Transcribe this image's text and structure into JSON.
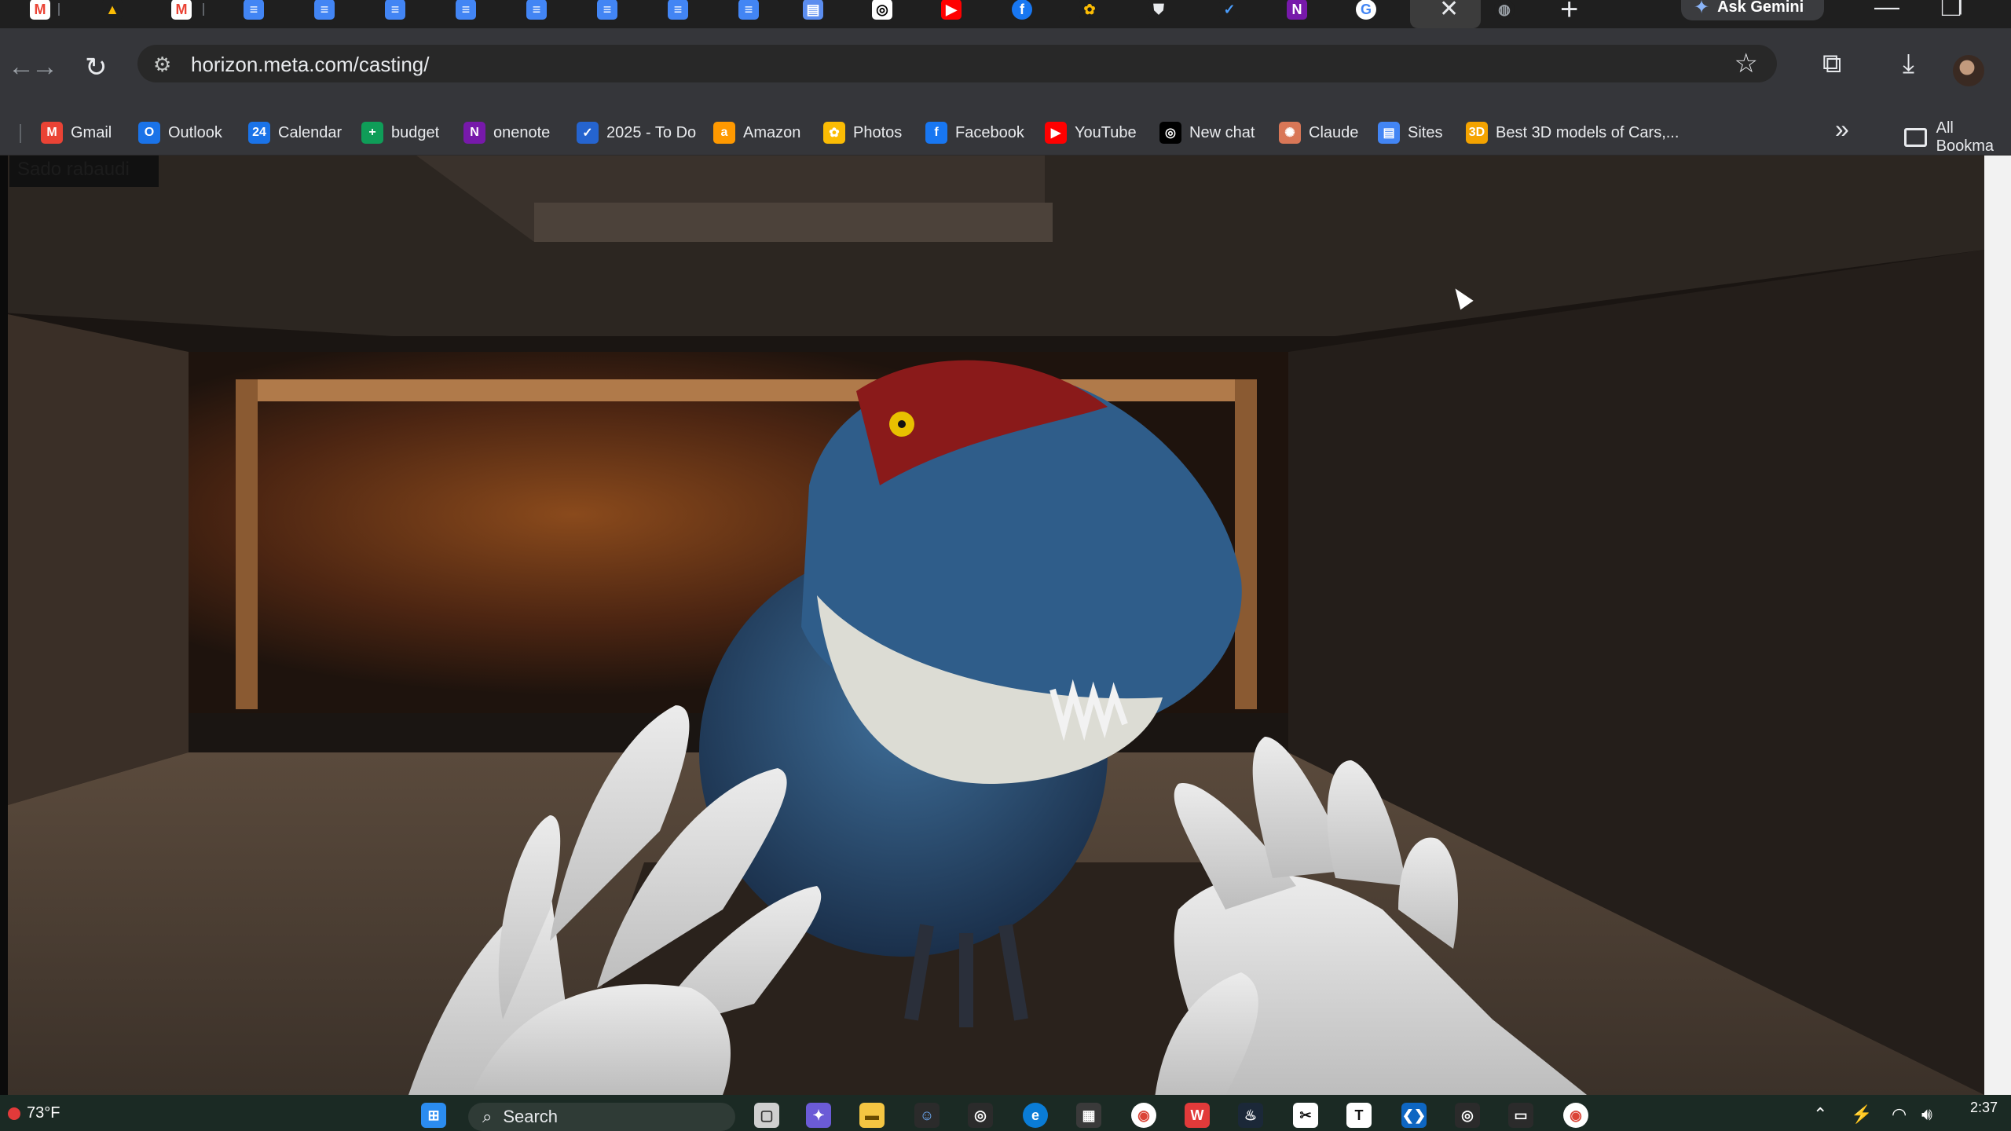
{
  "browser": {
    "tab_close": "✕",
    "new_tab": "+",
    "ask_gemini": "Ask Gemini",
    "url": "horizon.meta.com/casting/",
    "nav": {
      "back": "←",
      "forward": "→",
      "reload": "↻"
    },
    "window_controls": {
      "minimize": "—",
      "restore": "❐"
    }
  },
  "bookmarks": {
    "items": [
      {
        "label": "Gmail",
        "icon": "gmail-icon",
        "glyph": "M",
        "color": "#ea4335"
      },
      {
        "label": "Outlook",
        "icon": "outlook-icon",
        "glyph": "O",
        "color": "#1a73e8"
      },
      {
        "label": "Calendar",
        "icon": "calendar-icon",
        "glyph": "24",
        "color": "#1a73e8"
      },
      {
        "label": "budget",
        "icon": "sheets-icon",
        "glyph": "+",
        "color": "#0f9d58"
      },
      {
        "label": "onenote",
        "icon": "onenote-icon",
        "glyph": "N",
        "color": "#7719aa"
      },
      {
        "label": "2025 - To Do",
        "icon": "todo-icon",
        "glyph": "✓",
        "color": "#2564cf"
      },
      {
        "label": "Amazon",
        "icon": "amazon-icon",
        "glyph": "a",
        "color": "#ff9900"
      },
      {
        "label": "Photos",
        "icon": "photos-icon",
        "glyph": "✿",
        "color": "#fbbc04"
      },
      {
        "label": "Facebook",
        "icon": "facebook-icon",
        "glyph": "f",
        "color": "#1877f2"
      },
      {
        "label": "YouTube",
        "icon": "youtube-icon",
        "glyph": "▶",
        "color": "#ff0000"
      },
      {
        "label": "New chat",
        "icon": "openai-icon",
        "glyph": "◎",
        "color": "#000000"
      },
      {
        "label": "Claude",
        "icon": "claude-icon",
        "glyph": "✺",
        "color": "#d97757"
      },
      {
        "label": "Sites",
        "icon": "sites-icon",
        "glyph": "▤",
        "color": "#4285f4"
      },
      {
        "label": "Best 3D models of Cars,...",
        "icon": "3d-icon",
        "glyph": "3D",
        "color": "#f4a300"
      }
    ],
    "overflow": "»",
    "all_bookmarks": "All Bookma"
  },
  "cast": {
    "caster_name": "Sado rabaudi"
  },
  "taskbar": {
    "temperature": "73°F",
    "search_placeholder": "Search",
    "clock": "2:37"
  }
}
